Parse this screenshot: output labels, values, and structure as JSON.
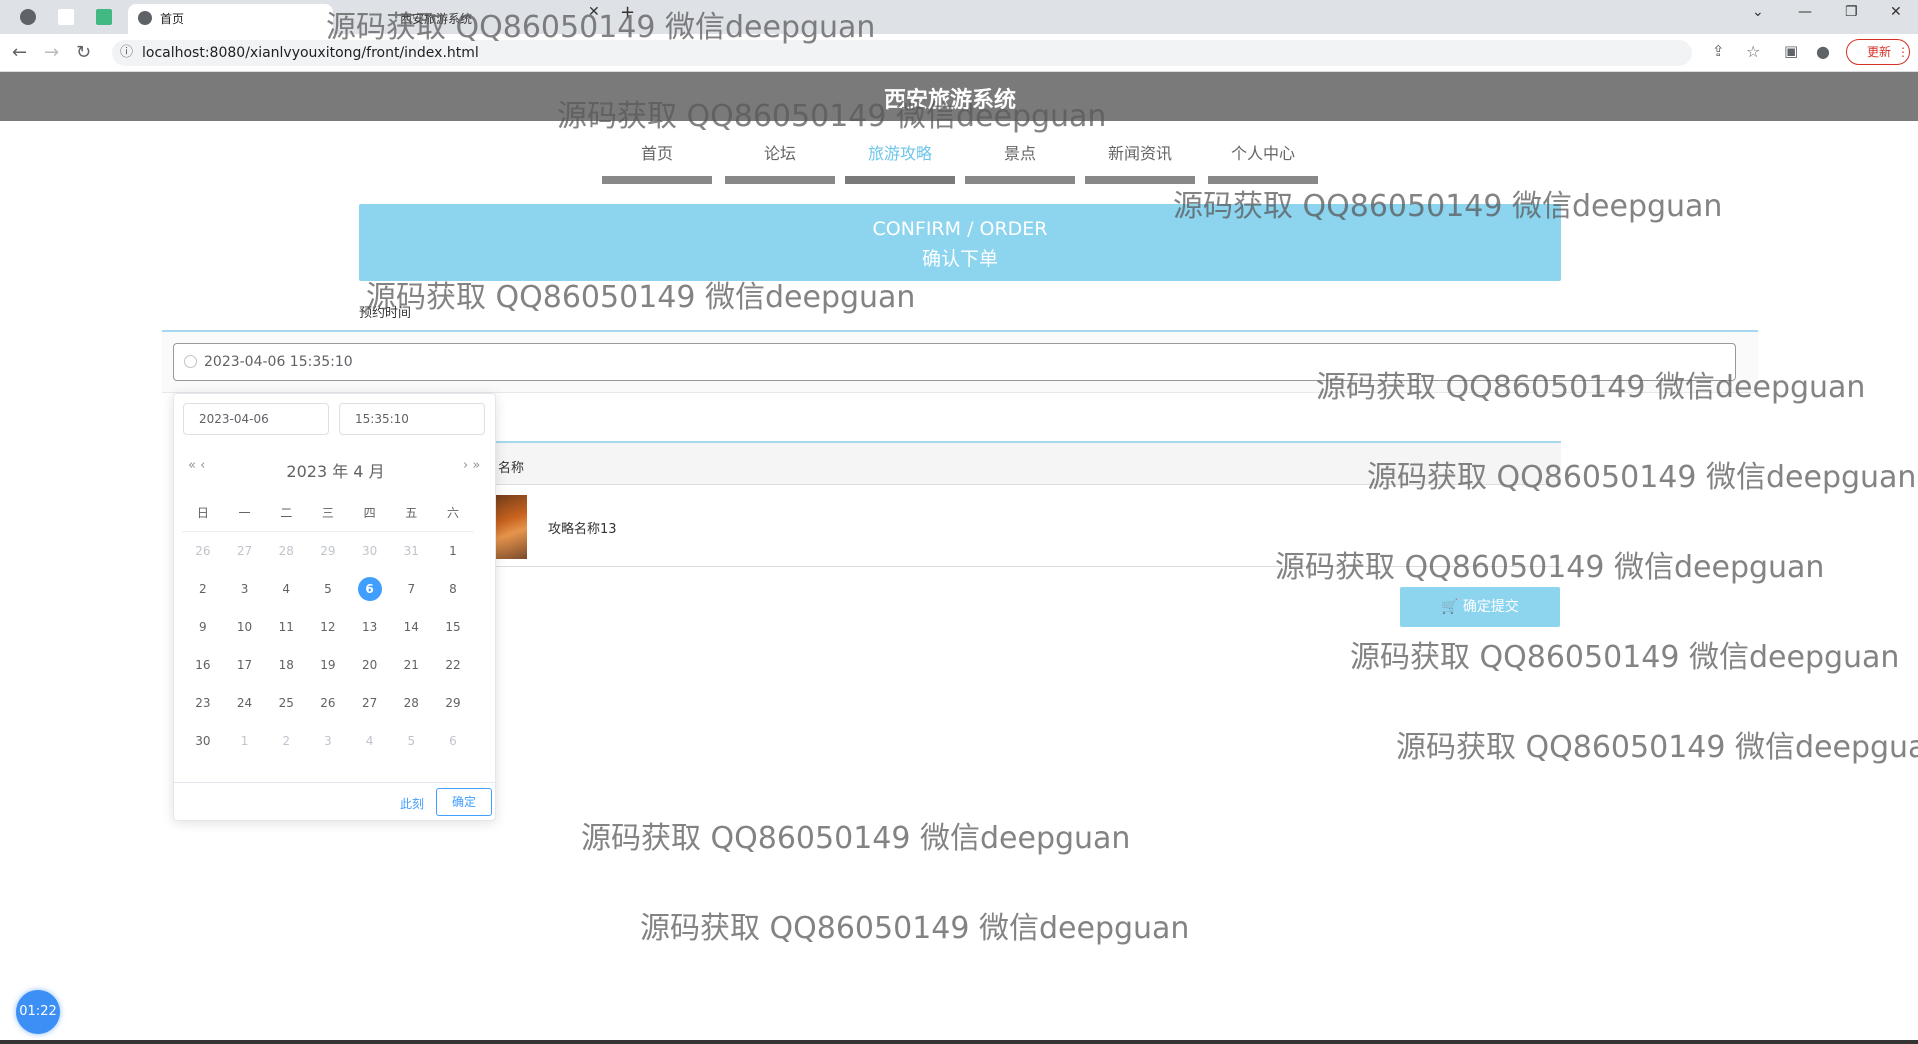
{
  "browser": {
    "active_tab": "首页",
    "inactive_tab": "西安旅游系统",
    "url": "localhost:8080/xianlvyouxitong/front/index.html",
    "update_label": "更新"
  },
  "site": {
    "title": "西安旅游系统"
  },
  "nav": {
    "items": [
      {
        "label": "首页"
      },
      {
        "label": "论坛"
      },
      {
        "label": "旅游攻略"
      },
      {
        "label": "景点"
      },
      {
        "label": "新闻资讯"
      },
      {
        "label": "个人中心"
      }
    ],
    "active": "旅游攻略"
  },
  "banner": {
    "line1": "CONFIRM / ORDER",
    "line2": "确认下单"
  },
  "form": {
    "reservation_label": "预约时间",
    "datetime_value": "2023-04-06 15:35:10"
  },
  "table": {
    "header_name": "名称",
    "row_name": "攻略名称13"
  },
  "submit_label": "🛒 确定提交",
  "picker": {
    "date_input": "2023-04-06",
    "time_input": "15:35:10",
    "header": "2023 年  4 月",
    "prev": "«  ‹",
    "next": "›  »",
    "weekdays": [
      "日",
      "一",
      "二",
      "三",
      "四",
      "五",
      "六"
    ],
    "weeks": [
      [
        "26",
        "27",
        "28",
        "29",
        "30",
        "31",
        "1"
      ],
      [
        "2",
        "3",
        "4",
        "5",
        "6",
        "7",
        "8"
      ],
      [
        "9",
        "10",
        "11",
        "12",
        "13",
        "14",
        "15"
      ],
      [
        "16",
        "17",
        "18",
        "19",
        "20",
        "21",
        "22"
      ],
      [
        "23",
        "24",
        "25",
        "26",
        "27",
        "28",
        "29"
      ],
      [
        "30",
        "1",
        "2",
        "3",
        "4",
        "5",
        "6"
      ]
    ],
    "selected_day": "6",
    "now_label": "此刻",
    "ok_label": "确定"
  },
  "watermark": "源码获取 QQ86050149 微信deepguan",
  "timer": "01:22"
}
